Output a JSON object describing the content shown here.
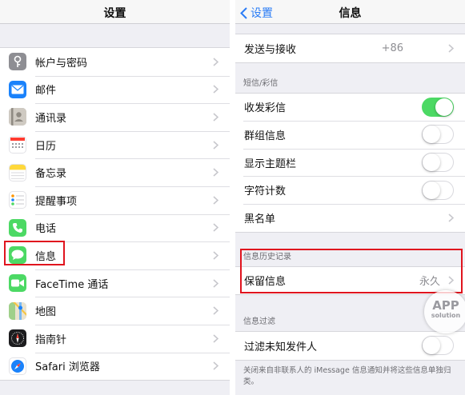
{
  "left": {
    "title": "设置",
    "items": [
      {
        "label": "帐户与密码",
        "icon": "key-icon",
        "color": "#8e8e93"
      },
      {
        "label": "邮件",
        "icon": "mail-icon",
        "color": "#1a82fb"
      },
      {
        "label": "通讯录",
        "icon": "contacts-icon",
        "color": "#b5b0a8"
      },
      {
        "label": "日历",
        "icon": "calendar-icon",
        "color": "#ffffff"
      },
      {
        "label": "备忘录",
        "icon": "notes-icon",
        "color": "#ffd83a"
      },
      {
        "label": "提醒事项",
        "icon": "reminders-icon",
        "color": "#ffffff"
      },
      {
        "label": "电话",
        "icon": "phone-icon",
        "color": "#4cd964"
      },
      {
        "label": "信息",
        "icon": "messages-icon",
        "color": "#4cd964"
      },
      {
        "label": "FaceTime 通话",
        "icon": "facetime-icon",
        "color": "#4cd964"
      },
      {
        "label": "地图",
        "icon": "maps-icon",
        "color": "#e9e3cf"
      },
      {
        "label": "指南针",
        "icon": "compass-icon",
        "color": "#1c1c1e"
      },
      {
        "label": "Safari 浏览器",
        "icon": "safari-icon",
        "color": "#ffffff"
      }
    ]
  },
  "right": {
    "back_label": "设置",
    "title": "信息",
    "send_receive": {
      "label": "发送与接收",
      "value": "+86"
    },
    "sms_section": {
      "header": "短信/彩信",
      "rows": [
        {
          "label": "收发彩信",
          "on": true
        },
        {
          "label": "群组信息",
          "on": false
        },
        {
          "label": "显示主题栏",
          "on": false
        },
        {
          "label": "字符计数",
          "on": false
        }
      ],
      "blacklist_label": "黑名单"
    },
    "history_section": {
      "header": "信息历史记录",
      "keep_label": "保留信息",
      "keep_value": "永久"
    },
    "filter_section": {
      "header": "信息过滤",
      "filter_label": "过滤未知发件人",
      "filter_on": false,
      "footer": "关闭来自非联系人的 iMessage 信息通知并将这些信息单独归类。"
    }
  },
  "watermark": {
    "line1": "APP",
    "line2": "solution"
  },
  "colors": {
    "accent": "#2a7cf6",
    "toggle_on": "#4cd964",
    "highlight": "#e0141e"
  }
}
